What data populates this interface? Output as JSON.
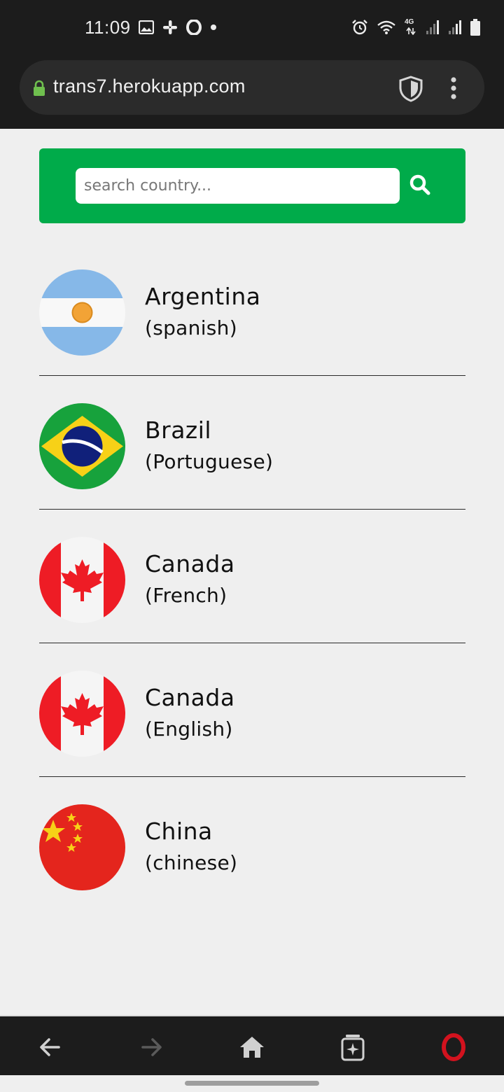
{
  "status_bar": {
    "time": "11:09",
    "network_label": "4G",
    "icons": [
      "image-icon",
      "slack-icon",
      "opera-icon",
      "dot-icon",
      "alarm-icon",
      "wifi-icon",
      "signal-icon",
      "signal-icon",
      "battery-icon"
    ]
  },
  "browser": {
    "url": "trans7.herokuapp.com",
    "icons": [
      "lock-icon",
      "shield-icon",
      "more-vert-icon"
    ]
  },
  "search": {
    "placeholder": "search country...",
    "value": "",
    "button_icon": "search-icon"
  },
  "countries": [
    {
      "name": "Argentina",
      "language": "(spanish)",
      "flag": "argentina-flag"
    },
    {
      "name": "Brazil",
      "language": "(Portuguese)",
      "flag": "brazil-flag"
    },
    {
      "name": "Canada",
      "language": "(French)",
      "flag": "canada-flag"
    },
    {
      "name": "Canada",
      "language": "(English)",
      "flag": "canada-flag"
    },
    {
      "name": "China",
      "language": "(chinese)",
      "flag": "china-flag"
    }
  ],
  "bottom_nav": {
    "icons": [
      "back-arrow-icon",
      "forward-arrow-icon",
      "home-icon",
      "tabs-icon",
      "opera-logo-icon"
    ]
  },
  "colors": {
    "accent_green": "#00ab4a",
    "status_bar_bg": "#1c1c1c",
    "page_bg": "#efefef",
    "opera_red": "#d2121e"
  }
}
